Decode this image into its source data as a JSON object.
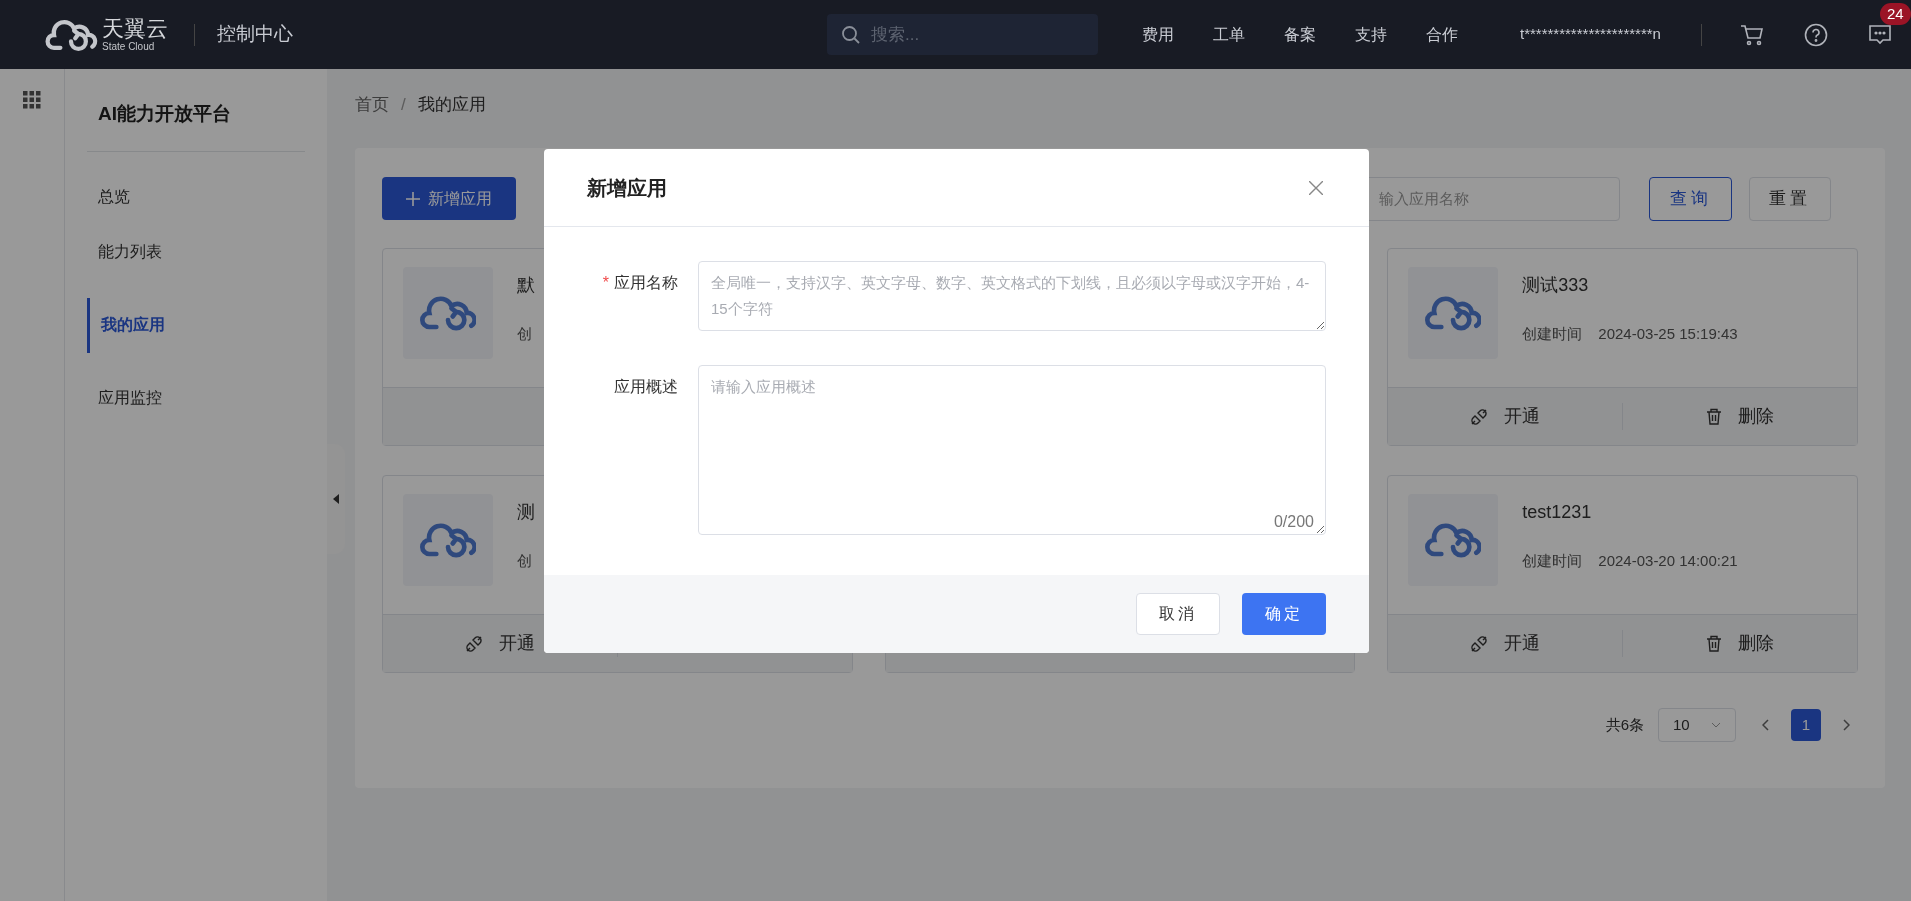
{
  "header": {
    "logo": {
      "name": "天翼云",
      "sub": "State Cloud"
    },
    "title": "控制中心",
    "search": {
      "placeholder": "搜索..."
    },
    "nav": [
      "费用",
      "工单",
      "备案",
      "支持",
      "合作"
    ],
    "user": "t**********************n",
    "badge": "24"
  },
  "sidebar": {
    "title": "AI能力开放平台",
    "items": [
      {
        "label": "总览",
        "selected": false
      },
      {
        "label": "能力列表",
        "selected": false
      },
      {
        "label": "我的应用",
        "selected": true
      },
      {
        "label": "应用监控",
        "selected": false
      }
    ]
  },
  "breadcrumb": {
    "separator": "/",
    "items": [
      "首页",
      "我的应用"
    ]
  },
  "toolbar": {
    "add_button": "新增应用",
    "search": {
      "placeholder": "输入应用名称"
    },
    "query_button": "查询",
    "reset_button": "重置"
  },
  "cards": [
    {
      "kind": "partial",
      "name": "默",
      "created_label": "创"
    },
    {
      "kind": "hidden"
    },
    {
      "kind": "full",
      "name": "测试333",
      "created_label": "创建时间",
      "created": "2024-03-25 15:19:43",
      "actions": [
        {
          "kind": "enable",
          "label": "开通"
        },
        {
          "kind": "delete",
          "label": "删除"
        }
      ]
    },
    {
      "kind": "partial",
      "name": "测",
      "created_label": "创",
      "actions": [
        {
          "kind": "enable",
          "label": "开通"
        }
      ]
    },
    {
      "kind": "covered"
    },
    {
      "kind": "full",
      "name": "test1231",
      "created_label": "创建时间",
      "created": "2024-03-20 14:00:21",
      "actions": [
        {
          "kind": "enable",
          "label": "开通"
        },
        {
          "kind": "delete",
          "label": "删除"
        }
      ]
    }
  ],
  "pagination": {
    "total": "共6条",
    "page_size": "10",
    "pages": [
      {
        "label": "1",
        "selected": true
      }
    ]
  },
  "dialog": {
    "title": "新增应用",
    "required_mark": "*",
    "fields": [
      {
        "label": "应用名称",
        "required": true,
        "placeholder": "全局唯一，支持汉字、英文字母、数字、英文格式的下划线，且必须以字母或汉字开始，4-15个字符",
        "kind": "short"
      },
      {
        "label": "应用概述",
        "required": false,
        "placeholder": "请输入应用概述",
        "counter": "0/200",
        "kind": "long"
      }
    ],
    "cancel": "取消",
    "confirm": "确定"
  }
}
